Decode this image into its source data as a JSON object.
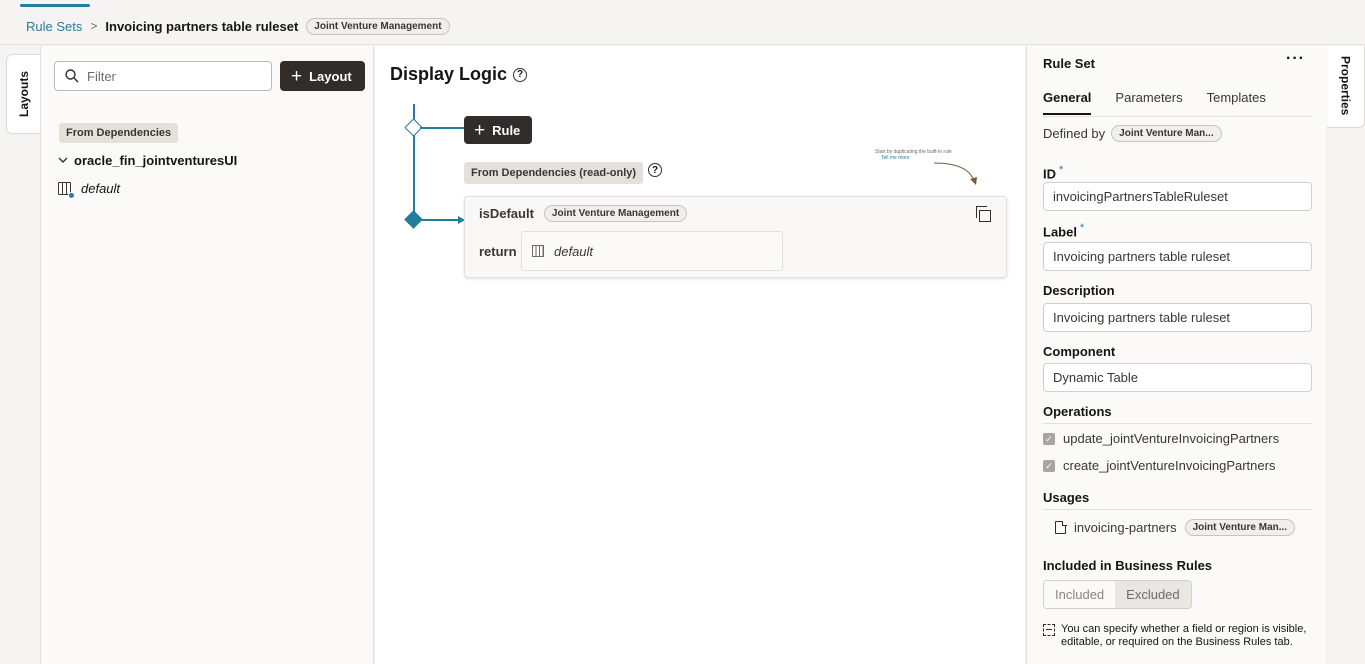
{
  "breadcrumb": {
    "root": "Rule Sets",
    "separator": ">",
    "current": "Invoicing partners table ruleset",
    "badge": "Joint Venture Management"
  },
  "left_rail": {
    "tab_label": "Layouts"
  },
  "layouts_panel": {
    "filter_placeholder": "Filter",
    "add_button": "Layout",
    "dependencies_label": "From Dependencies",
    "tree_parent": "oracle_fin_jointventuresUI",
    "tree_child": "default"
  },
  "canvas": {
    "title": "Display Logic",
    "add_rule_button": "Rule",
    "readonly_label": "From Dependencies (read-only)",
    "hint_text": "Start by duplicating the built-in rule",
    "hint_link": "Tell me more",
    "rule": {
      "name": "isDefault",
      "badge": "Joint Venture Management",
      "return_label": "return",
      "return_value": "default"
    }
  },
  "properties": {
    "title": "Rule Set",
    "more": "···",
    "tabs": [
      "General",
      "Parameters",
      "Templates"
    ],
    "defined_by_label": "Defined by",
    "defined_by_value": "Joint Venture Man...",
    "id_label": "ID",
    "id_value": "invoicingPartnersTableRuleset",
    "label_label": "Label",
    "label_value": "Invoicing partners table ruleset",
    "description_label": "Description",
    "description_value": "Invoicing partners table ruleset",
    "component_label": "Component",
    "component_value": "Dynamic Table",
    "operations_label": "Operations",
    "operations": [
      "update_jointVentureInvoicingPartners",
      "create_jointVentureInvoicingPartners"
    ],
    "usages_label": "Usages",
    "usage_name": "invoicing-partners",
    "usage_badge": "Joint Venture Man...",
    "business_rules_label": "Included in Business Rules",
    "included": "Included",
    "excluded": "Excluded",
    "info_text": "You can specify whether a field or region is visible, editable, or required on the Business Rules tab."
  },
  "right_rail": {
    "tab_label": "Properties"
  }
}
